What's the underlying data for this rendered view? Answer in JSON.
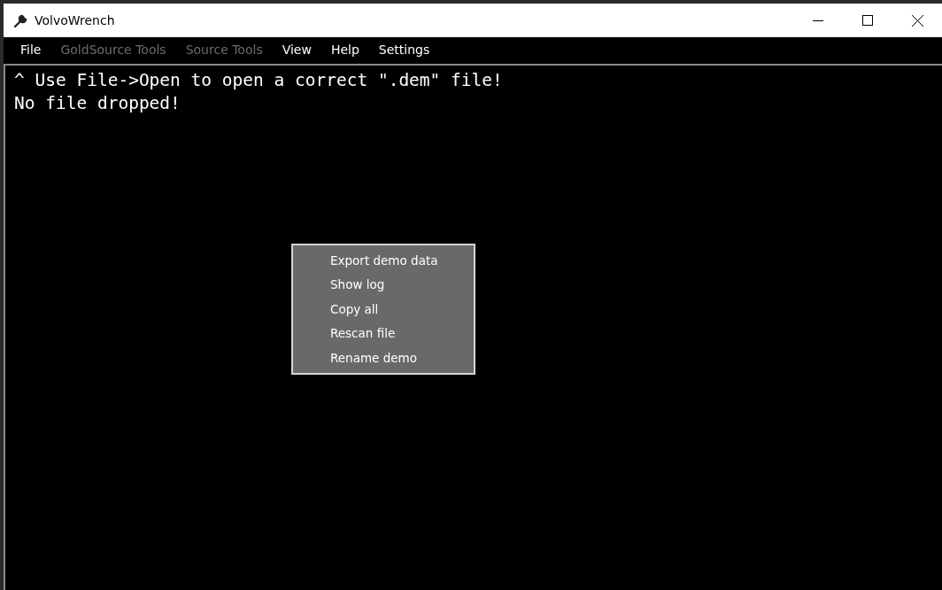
{
  "window": {
    "title": "VolvoWrench"
  },
  "menu_bar": [
    {
      "label": "File",
      "disabled": false
    },
    {
      "label": "GoldSource Tools",
      "disabled": true
    },
    {
      "label": "Source Tools",
      "disabled": true
    },
    {
      "label": "View",
      "disabled": false
    },
    {
      "label": "Help",
      "disabled": false
    },
    {
      "label": "Settings",
      "disabled": false
    }
  ],
  "console": {
    "lines": [
      "^ Use File->Open to open a correct \".dem\" file!",
      "No file dropped!"
    ]
  },
  "context_menu": {
    "items": [
      "Export demo data",
      "Show log",
      "Copy all",
      "Rescan file",
      "Rename demo"
    ]
  }
}
